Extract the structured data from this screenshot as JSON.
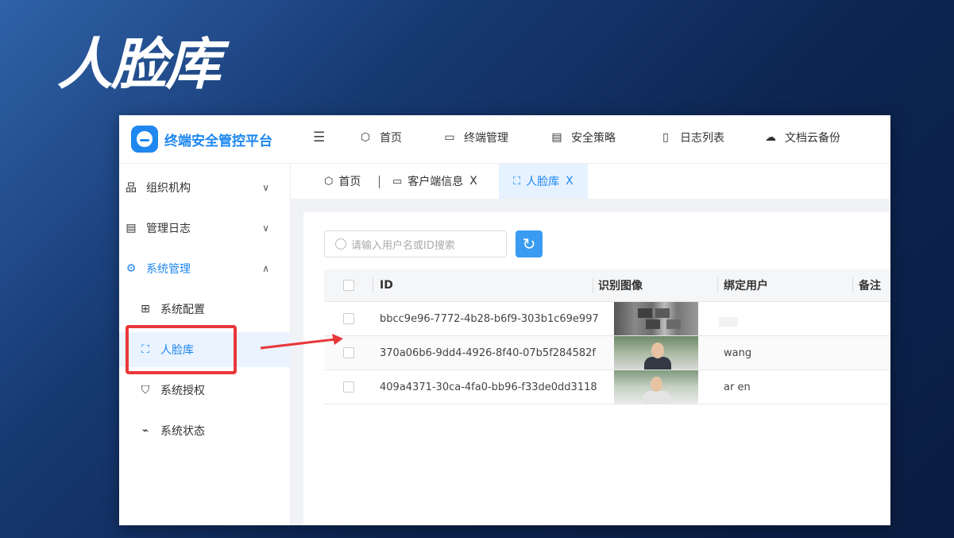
{
  "slide_title": "人脸库",
  "app": {
    "brand": "终端安全管控平台",
    "nav": [
      {
        "icon": "cube-icon",
        "label": "首页"
      },
      {
        "icon": "terminal-icon",
        "label": "终端管理"
      },
      {
        "icon": "policy-card-icon",
        "label": "安全策略"
      },
      {
        "icon": "document-icon",
        "label": "日志列表"
      },
      {
        "icon": "cloud-upload-icon",
        "label": "文档云备份"
      }
    ],
    "sidebar": [
      {
        "icon": "org-chart-icon",
        "label": "组织机构"
      },
      {
        "icon": "log-icon",
        "label": "管理日志"
      },
      {
        "icon": "gear-icon",
        "label": "系统管理"
      },
      {
        "icon": "settings-slider-icon",
        "label": "系统配置"
      },
      {
        "icon": "face-scan-icon",
        "label": "人脸库"
      },
      {
        "icon": "shield-check-icon",
        "label": "系统授权"
      },
      {
        "icon": "monitor-pulse-icon",
        "label": "系统状态"
      }
    ],
    "tabs": [
      {
        "icon": "cube-icon",
        "label": "首页"
      },
      {
        "icon": "terminal-icon",
        "label": "客户端信息"
      },
      {
        "icon": "face-scan-icon",
        "label": "人脸库"
      }
    ],
    "tab_close": "X",
    "search_placeholder": "请输入用户名或ID搜索",
    "columns": [
      "ID",
      "识别图像",
      "绑定用户",
      "备注"
    ],
    "rows": [
      {
        "id": "bbcc9e96-7772-4b28-b6f9-303b1c69e997",
        "user": ""
      },
      {
        "id": "370a06b6-9dd4-4926-8f40-07b5f284582f",
        "user": "wang"
      },
      {
        "id": "409a4371-30ca-4fa0-bb96-f33de0dd3118",
        "user": "ar      en"
      }
    ],
    "accent_color": "#1e87f0",
    "highlight_color": "#e8373a"
  }
}
